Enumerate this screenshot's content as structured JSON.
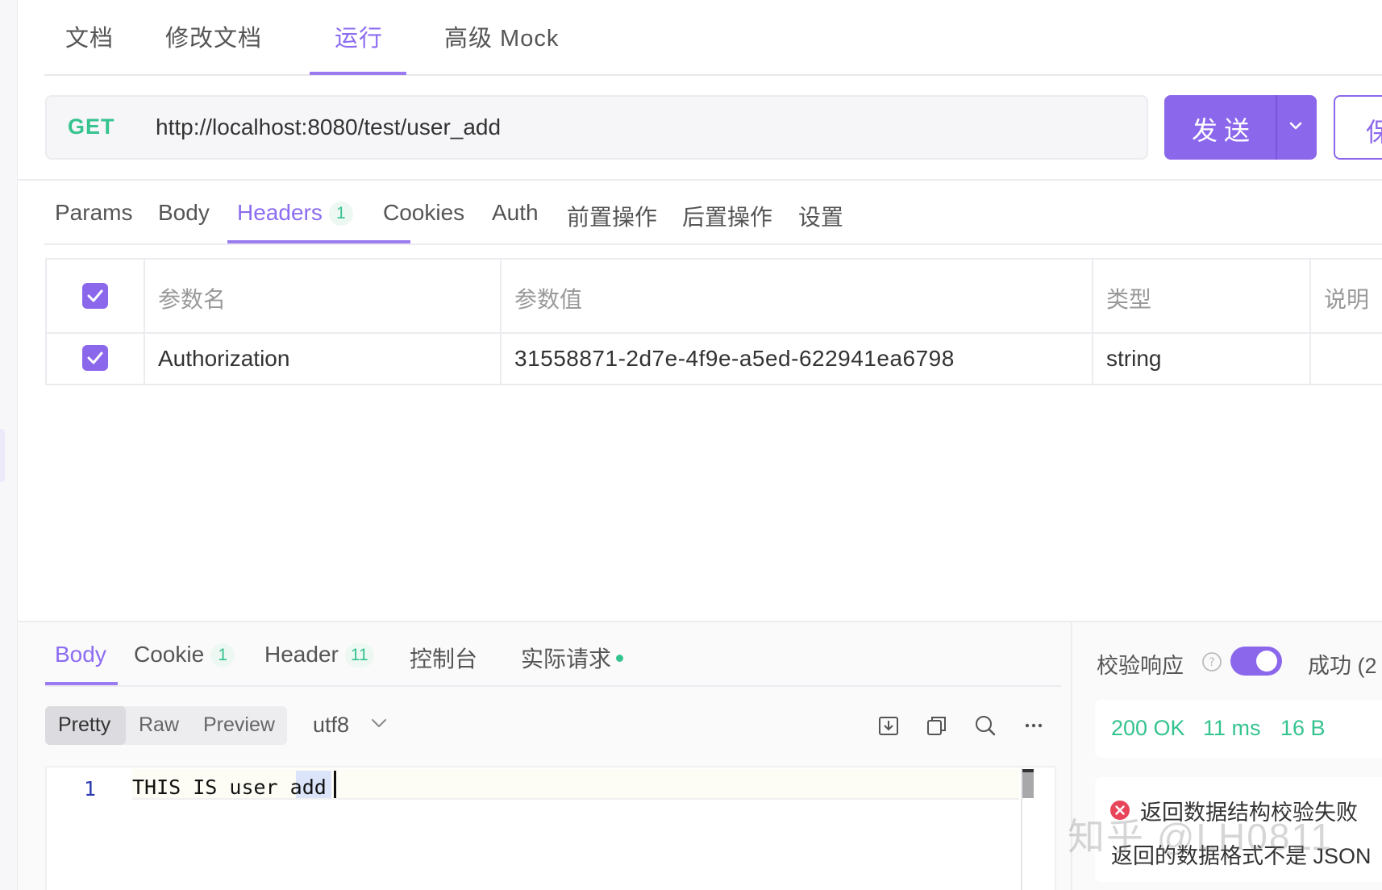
{
  "top_tabs": [
    {
      "label": "文档"
    },
    {
      "label": "修改文档"
    },
    {
      "label": "运行"
    },
    {
      "label": "高级 Mock"
    }
  ],
  "request": {
    "method": "GET",
    "url": "http://localhost:8080/test/user_add",
    "send_label": "发送",
    "save_label": "保"
  },
  "req_tabs": [
    {
      "label": "Params"
    },
    {
      "label": "Body"
    },
    {
      "label": "Headers",
      "badge": "1"
    },
    {
      "label": "Cookies"
    },
    {
      "label": "Auth"
    },
    {
      "label": "前置操作"
    },
    {
      "label": "后置操作"
    },
    {
      "label": "设置"
    }
  ],
  "headers_table": {
    "columns": [
      "参数名",
      "参数值",
      "类型",
      "说明"
    ],
    "rows": [
      {
        "name": "Authorization",
        "value": "31558871-2d7e-4f9e-a5ed-622941ea6798",
        "type": "string",
        "desc": "",
        "checked": true
      }
    ],
    "all_checked": true
  },
  "resp_tabs": [
    {
      "label": "Body"
    },
    {
      "label": "Cookie",
      "badge": "1"
    },
    {
      "label": "Header",
      "badge": "11"
    },
    {
      "label": "控制台"
    },
    {
      "label": "实际请求"
    }
  ],
  "format": {
    "options": [
      "Pretty",
      "Raw",
      "Preview"
    ],
    "selected": "Pretty",
    "encoding": "utf8"
  },
  "editor": {
    "line_number": "1",
    "code": "THIS IS user add"
  },
  "validation": {
    "label": "校验响应",
    "enabled": true,
    "result_label": "成功 (2"
  },
  "status": {
    "code": "200 OK",
    "time": "11 ms",
    "size": "16 B"
  },
  "error": {
    "title": "返回数据结构校验失败",
    "desc": "返回的数据格式不是 JSON"
  },
  "watermark": "知乎 @LH0811",
  "colors": {
    "accent": "#8b67eb",
    "success": "#35c38f",
    "error": "#e8455a"
  }
}
